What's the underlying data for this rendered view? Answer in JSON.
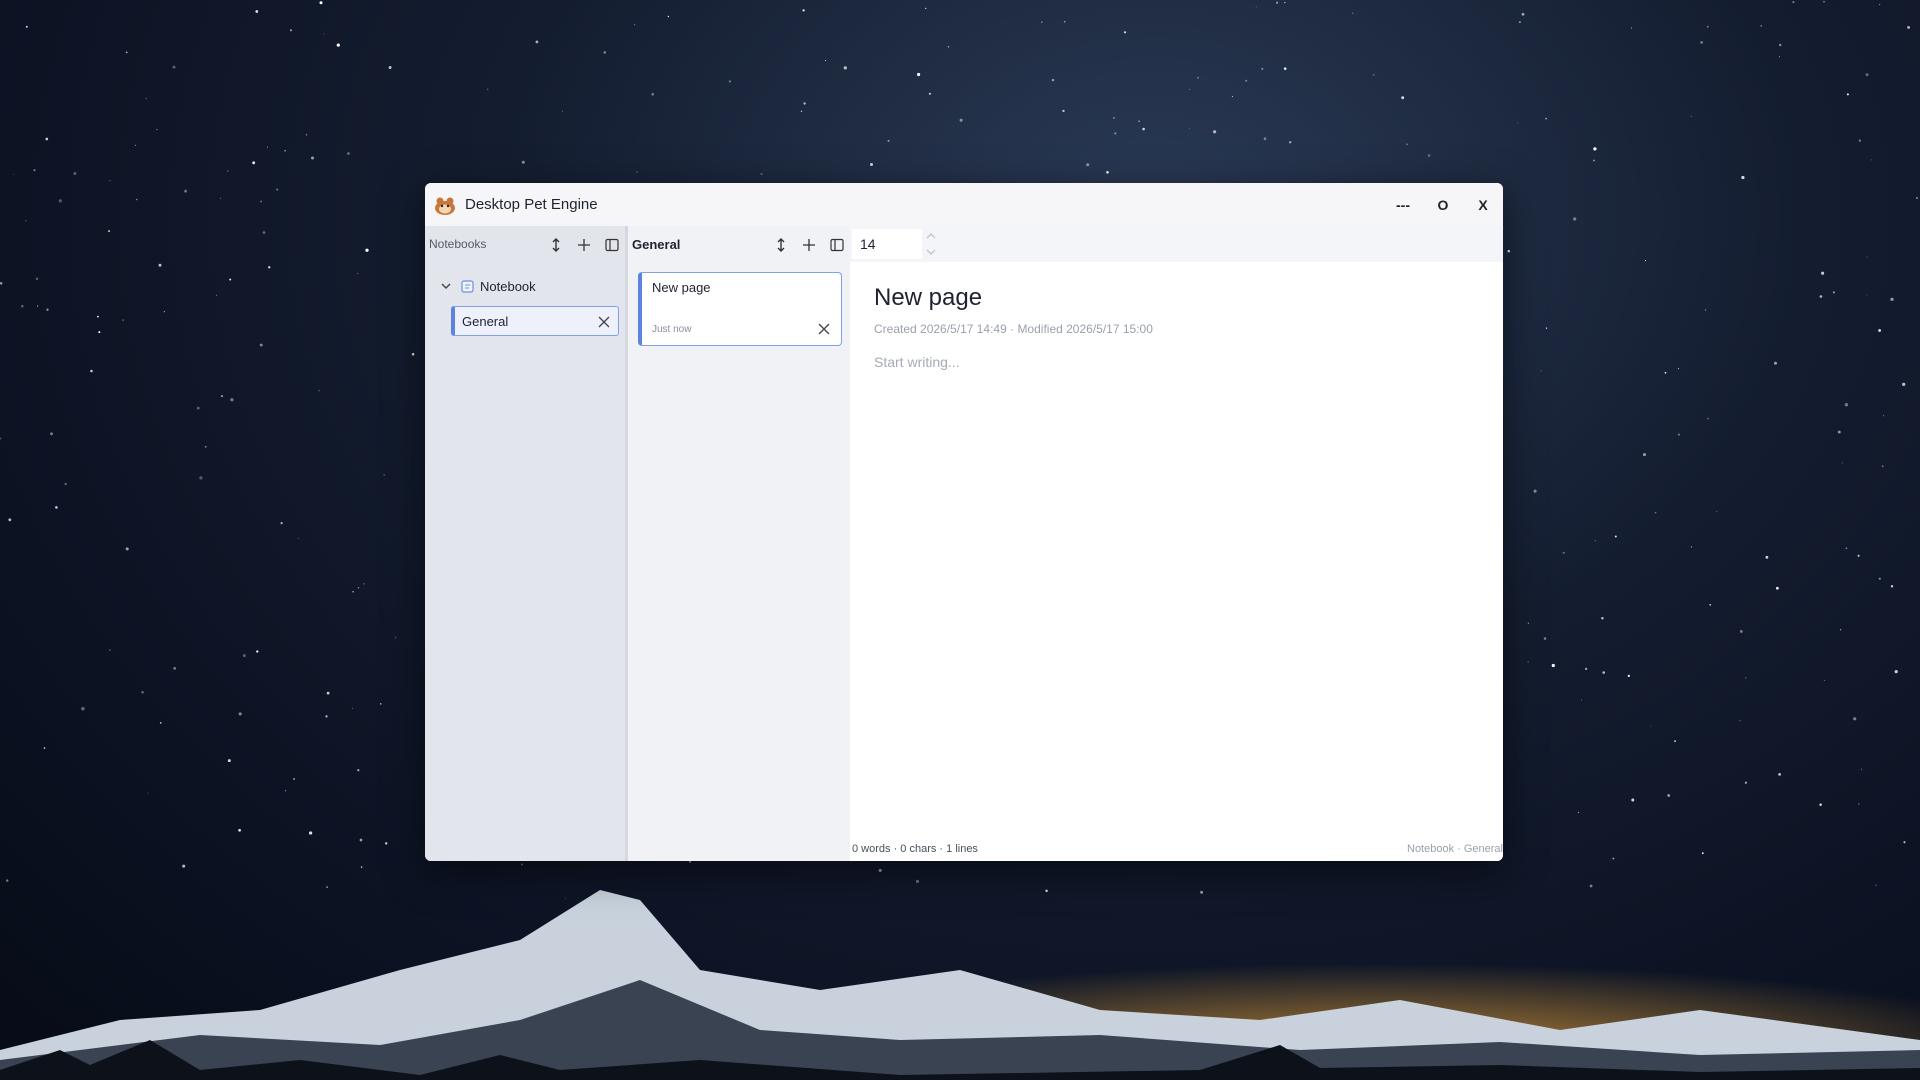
{
  "window": {
    "title": "Desktop Pet Engine",
    "controls": {
      "minimize": "---",
      "maximize": "O",
      "close": "X"
    }
  },
  "notebooks_panel": {
    "header": "Notebooks",
    "tree": [
      {
        "label": "Notebook",
        "expanded": true,
        "sections": [
          {
            "label": "General",
            "selected": true
          }
        ]
      }
    ]
  },
  "pages_panel": {
    "header": "General",
    "pages": [
      {
        "title": "New page",
        "time": "Just now",
        "selected": true
      }
    ]
  },
  "editor": {
    "font_size": "14",
    "title": "New page",
    "meta": "Created 2026/5/17 14:49 · Modified 2026/5/17 15:00",
    "placeholder": "Start writing..."
  },
  "status": {
    "stats": "0 words · 0 chars · 1 lines",
    "location": "Notebook · General"
  },
  "colors": {
    "accent": "#5b83df",
    "accent_border": "#7fa0ea",
    "notebooks_bg": "#e3e5ec",
    "pages_bg": "#f1f2f6"
  }
}
